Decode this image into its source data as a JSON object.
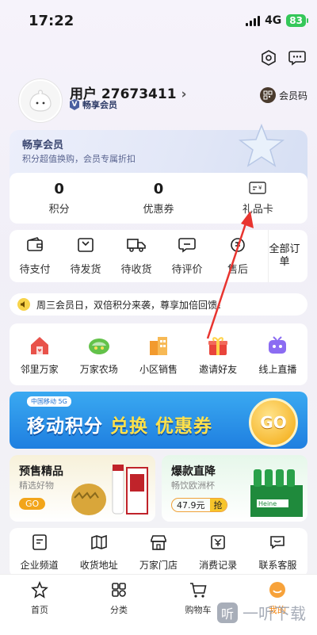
{
  "status": {
    "time": "17:22",
    "network": "4G",
    "battery": "83"
  },
  "profile": {
    "username": "用户 27673411",
    "arrow": "›",
    "member_level": "畅享会员",
    "member_code_label": "会员码"
  },
  "member_banner": {
    "title": "畅享会员",
    "subtitle": "积分超值换购，会员专属折扣"
  },
  "assets": [
    {
      "value": "0",
      "label": "积分"
    },
    {
      "value": "0",
      "label": "优惠券"
    },
    {
      "value": "",
      "label": "礼品卡"
    }
  ],
  "orders": [
    {
      "label": "待支付",
      "icon": "wallet-icon"
    },
    {
      "label": "待发货",
      "icon": "package-icon"
    },
    {
      "label": "待收货",
      "icon": "truck-icon"
    },
    {
      "label": "待评价",
      "icon": "comment-icon"
    },
    {
      "label": "售后",
      "icon": "aftersale-icon"
    }
  ],
  "orders_all": "全部订单",
  "notice": "周三会员日，双倍积分来袭，尊享加倍回馈！",
  "services": [
    {
      "label": "邻里万家",
      "icon": "house-icon",
      "color": "#e8524a"
    },
    {
      "label": "万家农场",
      "icon": "farm-icon",
      "color": "#63c24a"
    },
    {
      "label": "小区销售",
      "icon": "building-icon",
      "color": "#f29a2e"
    },
    {
      "label": "邀请好友",
      "icon": "gift-icon",
      "color": "#e9443b"
    },
    {
      "label": "线上直播",
      "icon": "live-icon",
      "color": "#8b6cf2"
    }
  ],
  "promo": {
    "logo_text": "中国移动 5G",
    "part1": "移动积分",
    "part2": "兑换",
    "part3": "优惠券",
    "go": "GO"
  },
  "featured": [
    {
      "title": "预售精品",
      "subtitle": "精选好物",
      "cta": "GO",
      "color": "#f6f0d8"
    },
    {
      "title": "爆款直降",
      "subtitle": "畅饮欧洲杯",
      "price": "47.9元",
      "tag": "抢",
      "color": "#e8f6ea"
    }
  ],
  "shortcuts": [
    {
      "label": "企业频道",
      "icon": "enterprise-icon"
    },
    {
      "label": "收货地址",
      "icon": "map-icon"
    },
    {
      "label": "万家门店",
      "icon": "store-icon"
    },
    {
      "label": "消费记录",
      "icon": "receipt-icon"
    },
    {
      "label": "联系客服",
      "icon": "service-icon"
    }
  ],
  "tabs": [
    {
      "label": "首页",
      "icon": "home-icon"
    },
    {
      "label": "分类",
      "icon": "category-icon"
    },
    {
      "label": "购物车",
      "icon": "cart-icon"
    },
    {
      "label": "我的",
      "icon": "profile-icon",
      "active": true
    }
  ],
  "watermark": "一听下载"
}
